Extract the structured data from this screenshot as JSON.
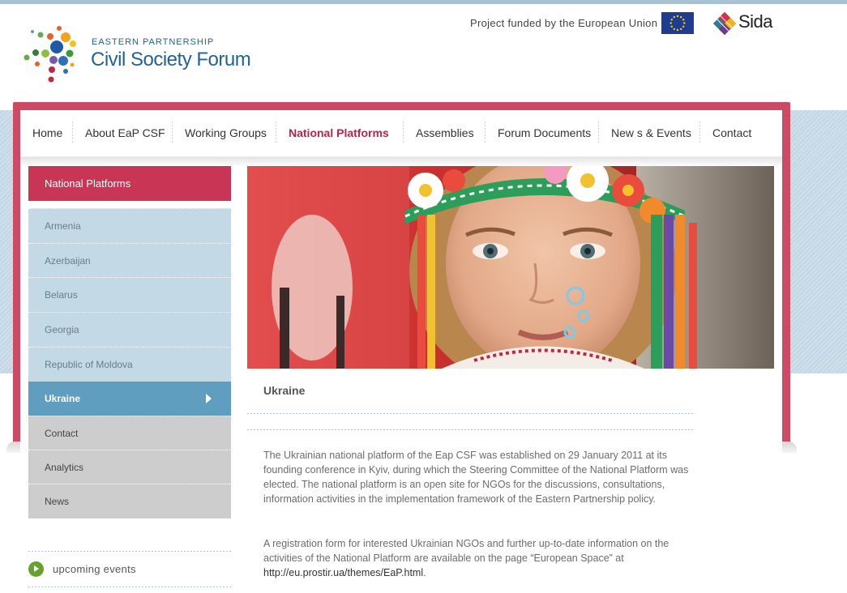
{
  "header": {
    "logo_small": "EASTERN PARTNERSHIP",
    "logo_big": "Civil Society Forum",
    "funded_text": "Project funded by the European Union",
    "sida_text": "Sida"
  },
  "nav": {
    "items": [
      {
        "label": "Home"
      },
      {
        "label": "About EaP CSF"
      },
      {
        "label": "Working Groups"
      },
      {
        "label": "National Platforms"
      },
      {
        "label": "Assemblies"
      },
      {
        "label": "Forum Documents"
      },
      {
        "label": "New s & Events"
      },
      {
        "label": "Contact"
      }
    ],
    "active": "National Platforms"
  },
  "sidebar": {
    "heading": "National Platforms",
    "items": [
      {
        "label": "Armenia"
      },
      {
        "label": "Azerbaijan"
      },
      {
        "label": "Belarus"
      },
      {
        "label": "Georgia"
      },
      {
        "label": "Republic of Moldova"
      },
      {
        "label": "Ukraine"
      },
      {
        "label": "Contact"
      },
      {
        "label": "Analytics"
      },
      {
        "label": "News"
      }
    ],
    "active": "Ukraine",
    "upcoming_label": "upcoming events"
  },
  "content": {
    "title": "Ukraine",
    "paragraph1": "The Ukrainian national platform of the Eap CSF was established on 29 January 2011 at its founding conference in Kyiv, during which the Steering Committee of the National Platform was elected. The national platform is an open site for NGOs for the discussions, consultations, information activities in the implementation framework of the Eastern Partnership policy.",
    "paragraph2_text": "A registration form for interested Ukrainian NGOs and further up-to-date information on the activities of the National Platform are available on the page “European Space” at",
    "paragraph2_link": "http://eu.prostir.ua/themes/EaP.html",
    "paragraph2_end": "."
  },
  "colors": {
    "brand_blue": "#24619a",
    "accent_pink": "#cc4a63",
    "sidebar_head": "#c93554",
    "sidebar_item": "#c4d9e6",
    "sidebar_active": "#5f9ebf",
    "sidebar_grey": "#cdcdcd",
    "nav_active": "#b8244a",
    "icon_green": "#66a32e"
  }
}
